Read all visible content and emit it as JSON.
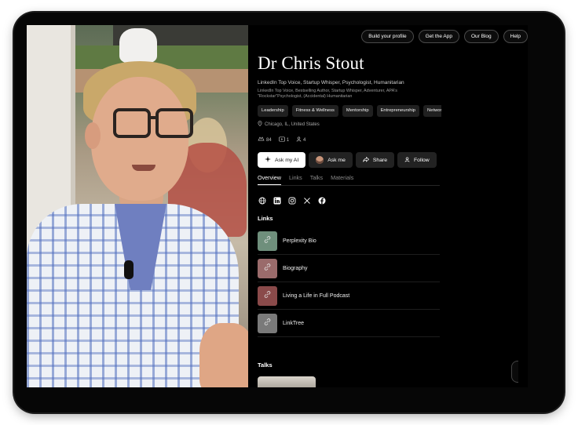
{
  "nav": {
    "buttons": [
      "Build your profile",
      "Get the App",
      "Our Blog",
      "Help"
    ]
  },
  "profile": {
    "name": "Dr Chris Stout",
    "headline": "LinkedIn Top Voice, Startup Whisper, Psychologist, Humanitarian",
    "bio": "LinkedIn Top Voice, Bestselling Author, Startup Whisper, Adventurer, APA's \"Rockstar\"Psychologist, (Accidental) Humanitarian",
    "tags": [
      "Leadership",
      "Fitness & Wellness",
      "Mentorship",
      "Entrepreneurship",
      "Networking B"
    ],
    "location": "Chicago, IL, United States",
    "stats": {
      "likes": "84",
      "media": "1",
      "followers": "4"
    }
  },
  "actions": {
    "ask_ai": "Ask my AI",
    "ask_me": "Ask me",
    "share": "Share",
    "follow": "Follow"
  },
  "tabs": [
    "Overview",
    "Links",
    "Talks",
    "Materials"
  ],
  "social_icons": [
    "globe-icon",
    "linkedin-icon",
    "instagram-icon",
    "x-icon",
    "facebook-icon"
  ],
  "sections": {
    "links": "Links",
    "talks": "Talks"
  },
  "links": [
    {
      "label": "Perplexity Bio",
      "color": "#6f8f7c"
    },
    {
      "label": "Biography",
      "color": "#9a6b6b"
    },
    {
      "label": "Living a Life in Full Podcast",
      "color": "#8a4a4a"
    },
    {
      "label": "LinkTree",
      "color": "#7a7a7a"
    }
  ],
  "colors": {
    "background": "#000000",
    "text": "#ffffff",
    "chip": "#202020"
  }
}
